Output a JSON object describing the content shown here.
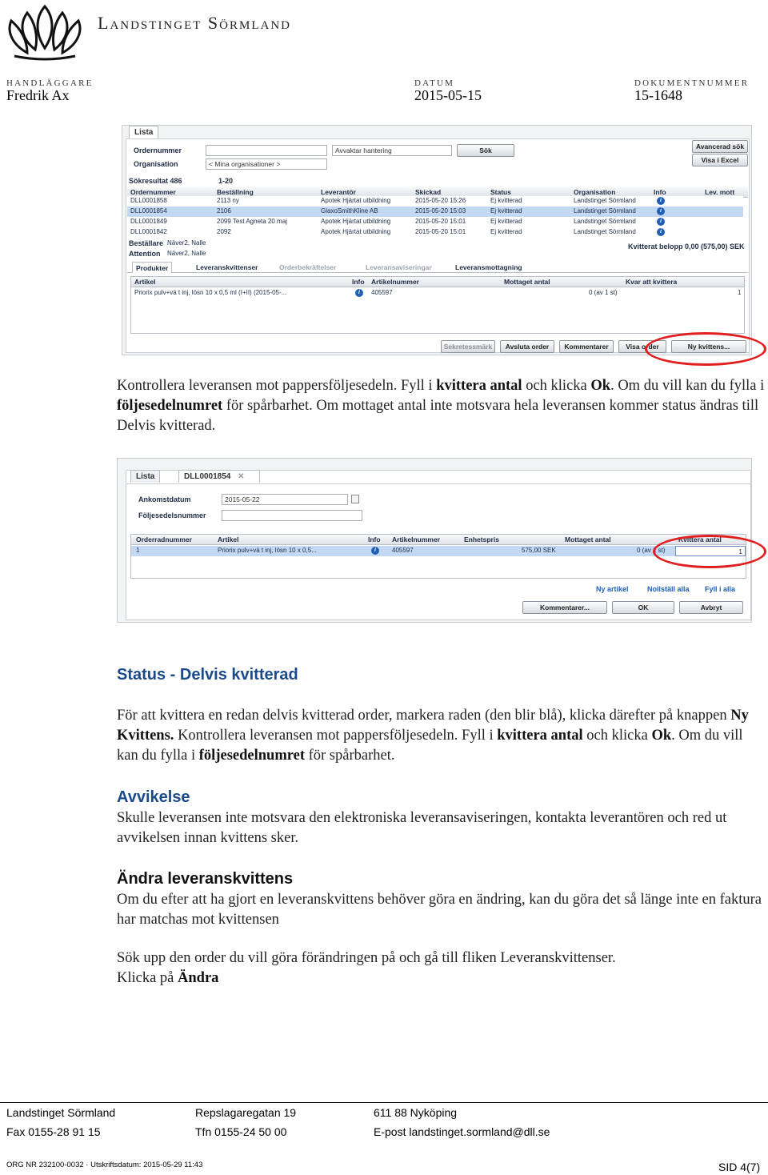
{
  "header": {
    "org_name": "Landstinget Sörmland",
    "handlaggare_label": "HANDLÄGGARE",
    "handlaggare": "Fredrik Ax",
    "datum_label": "DATUM",
    "datum": "2015-05-15",
    "dokument_label": "DOKUMENTNUMMER",
    "dokument": "15-1648"
  },
  "shot1": {
    "tab": "Lista",
    "ordernummer_label": "Ordernummer",
    "organisation_label": "Organisation",
    "organisation_value": "< Mina organisationer >",
    "status_value": "Avvaktar hantering",
    "search_button": "Sök",
    "advanced_button": "Avancerad sök",
    "excel_button": "Visa i Excel",
    "result_label": "Sökresultat 486",
    "range_label": "1-20",
    "columns": [
      "Ordernummer",
      "Beställning",
      "Leverantör",
      "Skickad",
      "Status",
      "Organisation",
      "Info",
      "Lev. mott"
    ],
    "rows": [
      {
        "order": "DLL0001858",
        "best": "2113 ny",
        "lev": "Apotek Hjärtat utbildning",
        "skickad": "2015-05-20 15:26",
        "status": "Ej kvitterad",
        "org": "Landstinget Sörmland"
      },
      {
        "order": "DLL0001854",
        "best": "2106",
        "lev": "GlaxoSmithKline AB",
        "skickad": "2015-05-20 15:03",
        "status": "Ej kvitterad",
        "org": "Landstinget Sörmland"
      },
      {
        "order": "DLL0001849",
        "best": "2099 Test Agneta 20 maj",
        "lev": "Apotek Hjärtat utbildning",
        "skickad": "2015-05-20 15:01",
        "status": "Ej kvitterad",
        "org": "Landstinget Sörmland"
      },
      {
        "order": "DLL0001842",
        "best": "2092",
        "lev": "Apotek Hjärtat utbildning",
        "skickad": "2015-05-20 15:01",
        "status": "Ej kvitterad",
        "org": "Landstinget Sörmland"
      }
    ],
    "bestallare_label": "Beställare",
    "bestallare": "Näver2, Nalle",
    "attention_label": "Attention",
    "attention": "Näver2, Nalle",
    "kvitterat": "Kvitterat belopp 0,00 (575,00) SEK",
    "subtabs": [
      "Produkter",
      "Leveranskvittenser",
      "Orderbekräftelser",
      "Leveransaviseringar",
      "Leveransmottagning"
    ],
    "detail_columns": [
      "Artikel",
      "Info",
      "Artikelnummer",
      "Mottaget antal",
      "Kvar att kvittera"
    ],
    "detail_row": {
      "artikel": "Priorix pulv+vä t inj, lösn 10 x 0,5 ml (I+II) (2015-05-...",
      "artnr": "405597",
      "mottaget": "0 (av 1 st)",
      "kvar": "1"
    },
    "buttons": [
      "Sekretessmärk",
      "Avsluta order",
      "Kommentarer",
      "Visa order",
      "Ny kvittens..."
    ]
  },
  "intro": {
    "t1": "Kontrollera leveransen mot pappersföljesedeln. Fyll i ",
    "b1": "kvittera antal",
    "t2": " och klicka ",
    "b2": "Ok",
    "t3": ". Om du vill kan du fylla i ",
    "b3": "följesedelnumret",
    "t4": " för spårbarhet. Om mottaget antal inte motsvara hela leveransen kommer status ändras till Delvis kvitterad."
  },
  "shot2": {
    "tab_list": "Lista",
    "tab_order": "DLL0001854",
    "ankomst_label": "Ankomstdatum",
    "ankomst_value": "2015-05-22",
    "foljesedel_label": "Följesedelsnummer",
    "columns": [
      "Orderradnummer",
      "Artikel",
      "Info",
      "Artikelnummer",
      "Enhetspris",
      "Mottaget antal",
      "Kvittera antal"
    ],
    "row": {
      "nr": "1",
      "artikel": "Priorix pulv+vä t inj, lösn 10 x 0,5...",
      "artnr": "405597",
      "pris": "575,00 SEK",
      "mottaget": "0 (av 1 st)",
      "kvittera": "1"
    },
    "links": [
      "Ny artikel",
      "Nollställ alla",
      "Fyll i alla"
    ],
    "buttons": [
      "Kommentarer...",
      "OK",
      "Avbryt"
    ]
  },
  "status_heading": "Status - Delvis kvitterad",
  "status_para": {
    "t1": "För att kvittera en redan delvis kvitterad order, markera raden (den blir blå), klicka därefter på knappen ",
    "b1": "Ny Kvittens.",
    "t2": " Kontrollera leveransen mot pappersföljesedeln. Fyll i ",
    "b2": "kvittera antal",
    "t3": " och klicka ",
    "b3": "Ok",
    "t4": ". Om du vill kan du fylla i ",
    "b4": "följesedelnumret",
    "t5": " för spårbarhet."
  },
  "avvikelse_heading": "Avvikelse",
  "avvikelse_text": "Skulle leveransen inte motsvara den elektroniska leveransaviseringen, kontakta leverantören och red ut avvikelsen innan kvittens sker.",
  "andra_heading": "Ändra leveranskvittens",
  "andra_text": "Om du efter att ha gjort en leveranskvittens behöver göra en ändring, kan du göra det så länge inte en faktura har matchas mot kvittensen",
  "sok_text": "Sök upp den order du vill göra förändringen på och gå till fliken Leveranskvittenser.",
  "klicka_text": "Klicka på ",
  "klicka_bold": "Ändra",
  "footer": {
    "c1r1": "Landstinget Sörmland",
    "c1r2": "Fax 0155-28 91 15",
    "c2r1": "Repslagaregatan 19",
    "c2r2": "Tfn 0155-24 50 00",
    "c3r1": "611 88 Nyköping",
    "c3r2": "E-post landstinget.sormland@dll.se",
    "orgnr": "ORG NR 232100-0032 · Utskriftsdatum: 2015-05-29 11:43",
    "sid": "SID 4(7)"
  }
}
